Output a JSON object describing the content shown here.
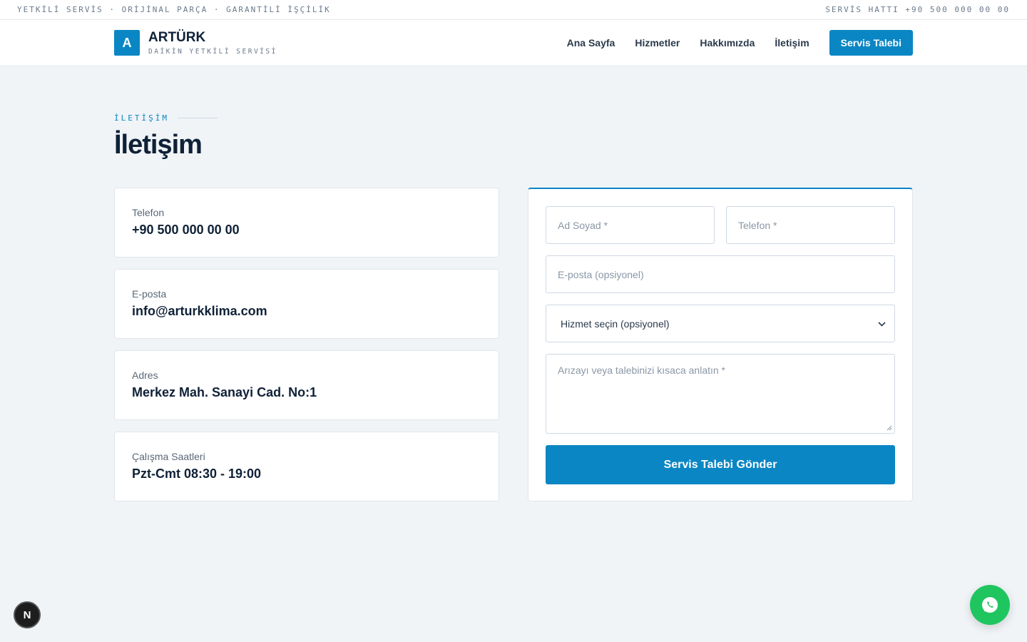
{
  "topbar": {
    "left_text": "YETKİLİ SERVİS · ORİJİNAL PARÇA · GARANTİLİ İŞÇİLİK",
    "right_text": "SERVİS HATTI +90 500 000 00 00"
  },
  "brand": {
    "logo_letter": "A",
    "name": "ARTÜRK",
    "subtitle": "DAİKİN YETKİLİ SERVİSİ"
  },
  "nav": {
    "links": [
      "Ana Sayfa",
      "Hizmetler",
      "Hakkımızda",
      "İletişim"
    ],
    "cta": "Servis Talebi"
  },
  "page": {
    "eyebrow": "İLETİŞİM",
    "title": "İletişim"
  },
  "info_cards": [
    {
      "label": "Telefon",
      "value": "+90 500 000 00 00"
    },
    {
      "label": "E-posta",
      "value": "info@arturkklima.com"
    },
    {
      "label": "Adres",
      "value": "Merkez Mah. Sanayi Cad. No:1"
    },
    {
      "label": "Çalışma Saatleri",
      "value": "Pzt-Cmt 08:30 - 19:00"
    }
  ],
  "form": {
    "name_placeholder": "Ad Soyad *",
    "phone_placeholder": "Telefon *",
    "email_placeholder": "E-posta (opsiyonel)",
    "service_select": "Hizmet seçin (opsiyonel)",
    "message_placeholder": "Arızayı veya talebinizi kısaca anlatın *",
    "submit_label": "Servis Talebi Gönder"
  },
  "colors": {
    "accent": "#0a86c4",
    "whatsapp": "#1fc55f",
    "background": "#f0f4f7",
    "text_dark": "#0f2137"
  },
  "icons": {
    "dev_badge": "nextjs-icon",
    "whatsapp": "whatsapp-icon",
    "select_chevron": "chevron-down-icon"
  },
  "dev_badge_letter": "N"
}
